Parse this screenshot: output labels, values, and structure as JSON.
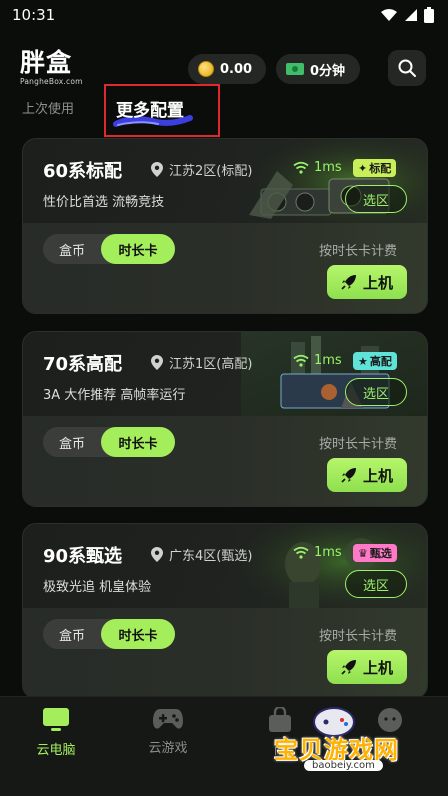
{
  "status_bar": {
    "time": "10:31"
  },
  "header": {
    "logo_text": "胖盒",
    "logo_subtext": "PangheBox.com",
    "coin_balance": "0.00",
    "time_balance": "0分钟"
  },
  "tabs": {
    "recent": "上次使用",
    "more_config": "更多配置"
  },
  "cards": [
    {
      "title": "60系标配",
      "region": "江苏2区(标配)",
      "latency": "1ms",
      "badge": "标配",
      "badge_color": "#c8ef5a",
      "description": "性价比首选 流畅竞技",
      "select_label": "选区",
      "toggle_coin": "盒币",
      "toggle_card": "时长卡",
      "billing": "按时长卡计费",
      "launch_label": "上机"
    },
    {
      "title": "70系高配",
      "region": "江苏1区(高配)",
      "latency": "1ms",
      "badge": "高配",
      "badge_color": "#5fe2d7",
      "description": "3A 大作推荐 高帧率运行",
      "select_label": "选区",
      "toggle_coin": "盒币",
      "toggle_card": "时长卡",
      "billing": "按时长卡计费",
      "launch_label": "上机"
    },
    {
      "title": "90系甄选",
      "region": "广东4区(甄选)",
      "latency": "1ms",
      "badge": "甄选",
      "badge_color": "#ff79c6",
      "description": "极致光追 机皇体验",
      "select_label": "选区",
      "toggle_coin": "盒币",
      "toggle_card": "时长卡",
      "billing": "按时长卡计费",
      "launch_label": "上机"
    }
  ],
  "bottom_nav": [
    {
      "label": "云电脑",
      "icon": "monitor-icon"
    },
    {
      "label": "云游戏",
      "icon": "gamepad-icon"
    },
    {
      "label": "商",
      "icon": "shopping-bag-icon"
    },
    {
      "label": "",
      "icon": "profile-icon"
    }
  ],
  "watermark": {
    "text": "宝贝游戏网",
    "url": "baobeiy.com"
  },
  "colors": {
    "accent": "#a4ee5c",
    "background": "#0b0d0b",
    "highlight_box": "#e0282f"
  }
}
